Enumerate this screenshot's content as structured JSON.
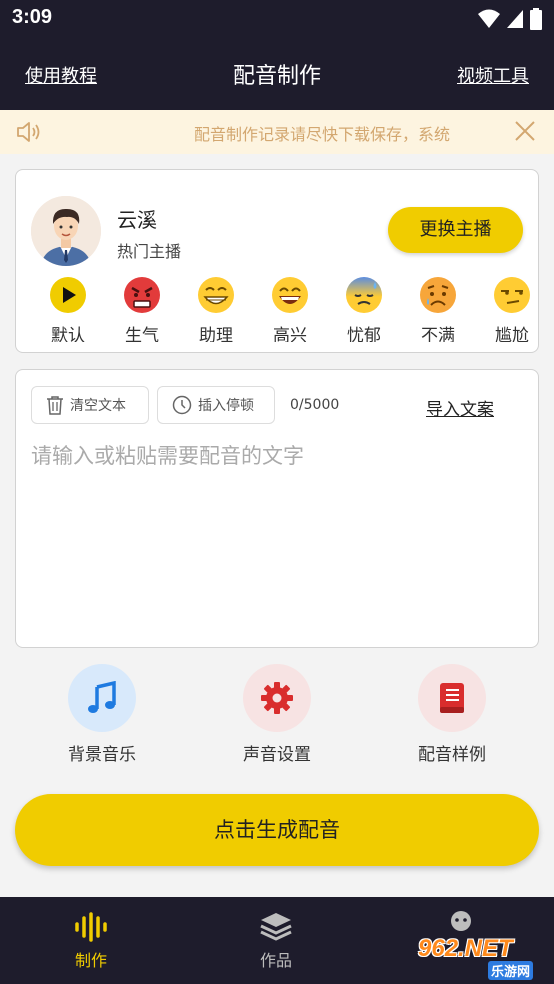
{
  "status": {
    "time": "3:09"
  },
  "nav": {
    "left": "使用教程",
    "title": "配音制作",
    "right": "视频工具"
  },
  "notice": {
    "text": "配音制作记录请尽快下载保存，系统"
  },
  "anchor": {
    "name": "云溪",
    "type": "热门主播",
    "change_label": "更换主播"
  },
  "emotions": [
    {
      "label": "默认",
      "icon": "play-icon"
    },
    {
      "label": "生气",
      "icon": "angry-face-icon"
    },
    {
      "label": "助理",
      "icon": "grin-face-icon"
    },
    {
      "label": "高兴",
      "icon": "happy-face-icon"
    },
    {
      "label": "忧郁",
      "icon": "sad-sweat-face-icon"
    },
    {
      "label": "不满",
      "icon": "worried-face-icon"
    },
    {
      "label": "尴尬",
      "icon": "unamused-face-icon"
    }
  ],
  "editor": {
    "clear_label": "清空文本",
    "pause_label": "插入停顿",
    "counter": "0/5000",
    "import_label": "导入文案",
    "placeholder": "请输入或粘贴需要配音的文字"
  },
  "features": [
    {
      "label": "背景音乐",
      "icon": "music-note-icon",
      "color": "#1e7ae0",
      "bg": "#d8e9fb"
    },
    {
      "label": "声音设置",
      "icon": "gear-icon",
      "color": "#d92d2d",
      "bg": "#f7e3e3"
    },
    {
      "label": "配音样例",
      "icon": "book-icon",
      "color": "#d92d2d",
      "bg": "#f7e3e3"
    }
  ],
  "generate_label": "点击生成配音",
  "tabs": [
    {
      "label": "制作",
      "active": true
    },
    {
      "label": "作品",
      "active": false
    }
  ],
  "watermark": {
    "logo": "962.NET",
    "sub": "乐游网"
  },
  "colors": {
    "accent": "#f0cc00",
    "dark": "#1e1c2c",
    "notice_text": "#d3a770"
  }
}
